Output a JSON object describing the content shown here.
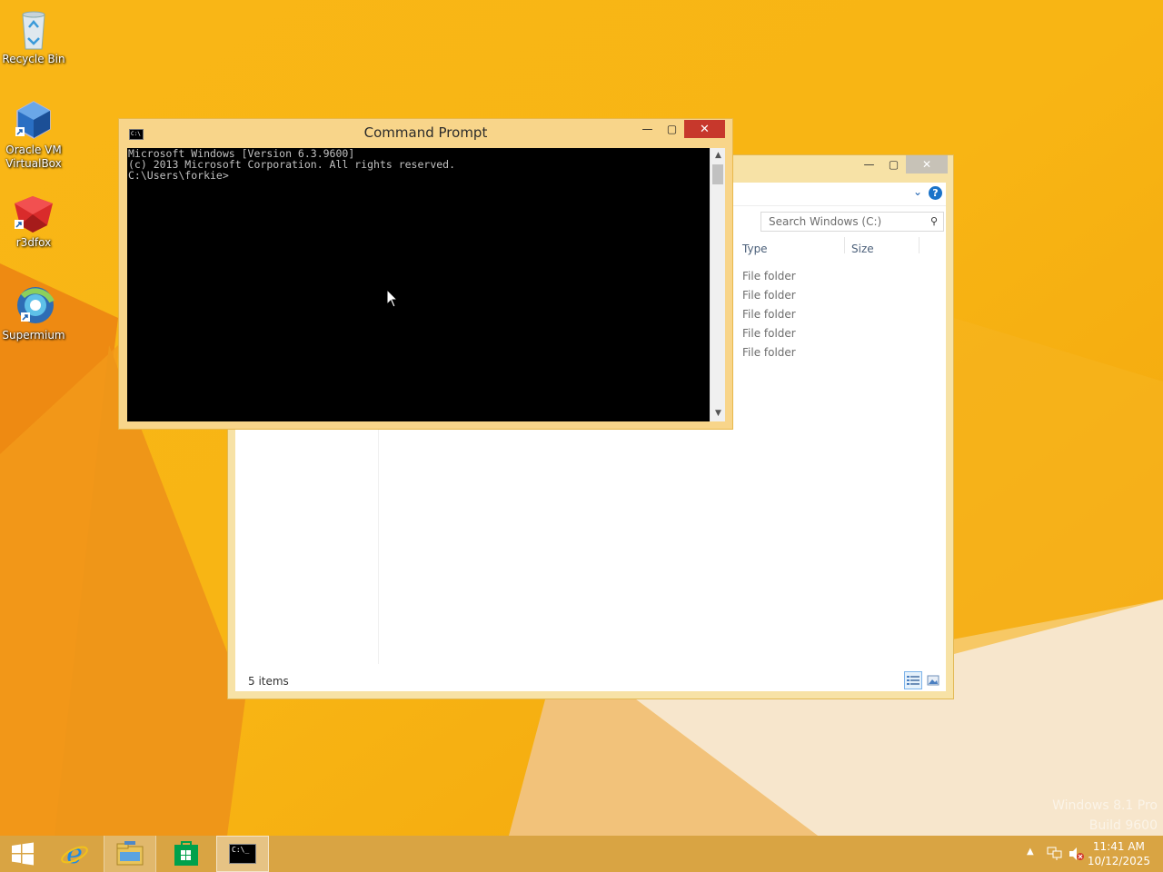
{
  "desktop": {
    "icons": [
      {
        "label": "Recycle Bin"
      },
      {
        "label": "Oracle VM VirtualBox"
      },
      {
        "label": "r3dfox"
      },
      {
        "label": "Supermium"
      }
    ],
    "watermark_line1": "Windows 8.1 Pro",
    "watermark_line2": "Build 9600"
  },
  "cmd": {
    "title": "Command Prompt",
    "icon_text": "C:\\",
    "lines": [
      "Microsoft Windows [Version 6.3.9600]",
      "(c) 2013 Microsoft Corporation. All rights reserved.",
      "",
      "C:\\Users\\forkie>"
    ]
  },
  "explorer": {
    "search_placeholder": "Search Windows (C:)",
    "columns": {
      "type": "Type",
      "size": "Size"
    },
    "rows": [
      "File folder",
      "File folder",
      "File folder",
      "File folder",
      "File folder"
    ],
    "status": "5 items"
  },
  "taskbar": {
    "time": "11:41 AM",
    "date": "10/12/2025",
    "cmd_icon_text": "C:\\_"
  },
  "colors": {
    "cmd_close": "#c7382c",
    "accent": "#f8d58a",
    "help_blue": "#1a73c9"
  }
}
